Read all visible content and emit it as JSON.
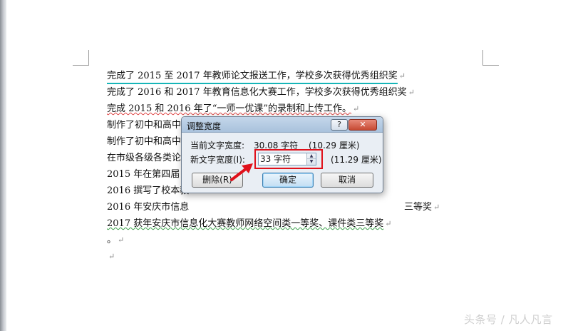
{
  "document": {
    "lines": [
      "完成了 2015 至 2017 年教师论文报送工作，学校多次获得优秀组织奖",
      "完成了 2016 和 2017 年教育信息化大赛工作，学校多次获得优秀组织奖",
      "完成 2015 和 2016 年了“一师一优课”的录制和上传工作。",
      "制作了初中和高中",
      "制作了初中和高中",
      "在市级各级各类论",
      "2015 年在第四届《",
      "2016 撰写了校本教",
      "2016 年安庆市信息",
      "2017 获年安庆市信息化大赛教师网络空间类一等奖、课件类三等奖",
      "。"
    ],
    "line9_tail": "三等奖",
    "paragraph_mark": "↵"
  },
  "dialog": {
    "title": "调整宽度",
    "help_label": "?",
    "close_label": "✕",
    "current_width_label": "当前文字宽度:",
    "current_width_value": "30.08 字符",
    "current_width_cm": "(10.29 厘米)",
    "new_width_label": "新文字宽度(I):",
    "new_width_value": "33 字符",
    "new_width_cm": "(11.29 厘米)",
    "delete_button": "删除(R)",
    "ok_button": "确定",
    "cancel_button": "取消"
  },
  "watermark": "头条号 / 凡人凡言",
  "colors": {
    "selection_underline": "#16b5b8",
    "highlight_box": "#e0101a",
    "arrow": "#e0101a"
  }
}
